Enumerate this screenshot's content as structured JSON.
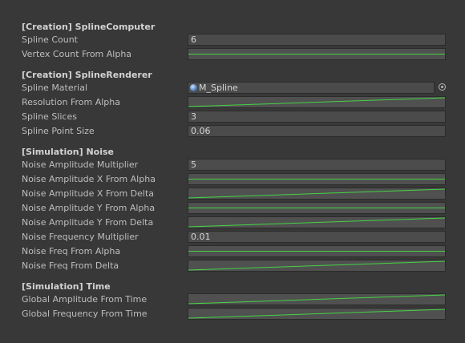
{
  "sections": [
    {
      "title": "[Creation] SplineComputer",
      "rows": [
        {
          "label": "Spline Count",
          "type": "text",
          "value": "6"
        },
        {
          "label": "Vertex Count From Alpha",
          "type": "curve",
          "curve": "flat"
        }
      ]
    },
    {
      "title": "[Creation] SplineRenderer",
      "rows": [
        {
          "label": "Spline Material",
          "type": "object",
          "value": "M_Spline",
          "icon": "material-sphere-icon"
        },
        {
          "label": "Resolution From Alpha",
          "type": "curve",
          "curve": "ramp"
        },
        {
          "label": "Spline Slices",
          "type": "text",
          "value": "3"
        },
        {
          "label": "Spline Point Size",
          "type": "text",
          "value": "0.06"
        }
      ]
    },
    {
      "title": "[Simulation] Noise",
      "rows": [
        {
          "label": "Noise Amplitude Multiplier",
          "type": "text",
          "value": "5"
        },
        {
          "label": "Noise Amplitude X From Alpha",
          "type": "curve",
          "curve": "flat"
        },
        {
          "label": "Noise Amplitude X From Delta",
          "type": "curve",
          "curve": "ramp"
        },
        {
          "label": "Noise Amplitude Y From Alpha",
          "type": "curve",
          "curve": "flat"
        },
        {
          "label": "Noise Amplitude Y From Delta",
          "type": "curve",
          "curve": "ramp"
        },
        {
          "label": "Noise Frequency Multiplier",
          "type": "text",
          "value": "0.01"
        },
        {
          "label": "Noise Freq From Alpha",
          "type": "curve",
          "curve": "flat"
        },
        {
          "label": "Noise Freq From Delta",
          "type": "curve",
          "curve": "ramp"
        }
      ]
    },
    {
      "title": "[Simulation] Time",
      "rows": [
        {
          "label": "Global Amplitude From Time",
          "type": "curve",
          "curve": "ramp"
        },
        {
          "label": "Global Frequency From Time",
          "type": "curve",
          "curve": "ramp"
        }
      ]
    }
  ],
  "colors": {
    "background": "#383838",
    "curve_line": "#44d444",
    "field": "#4b4b4b"
  }
}
